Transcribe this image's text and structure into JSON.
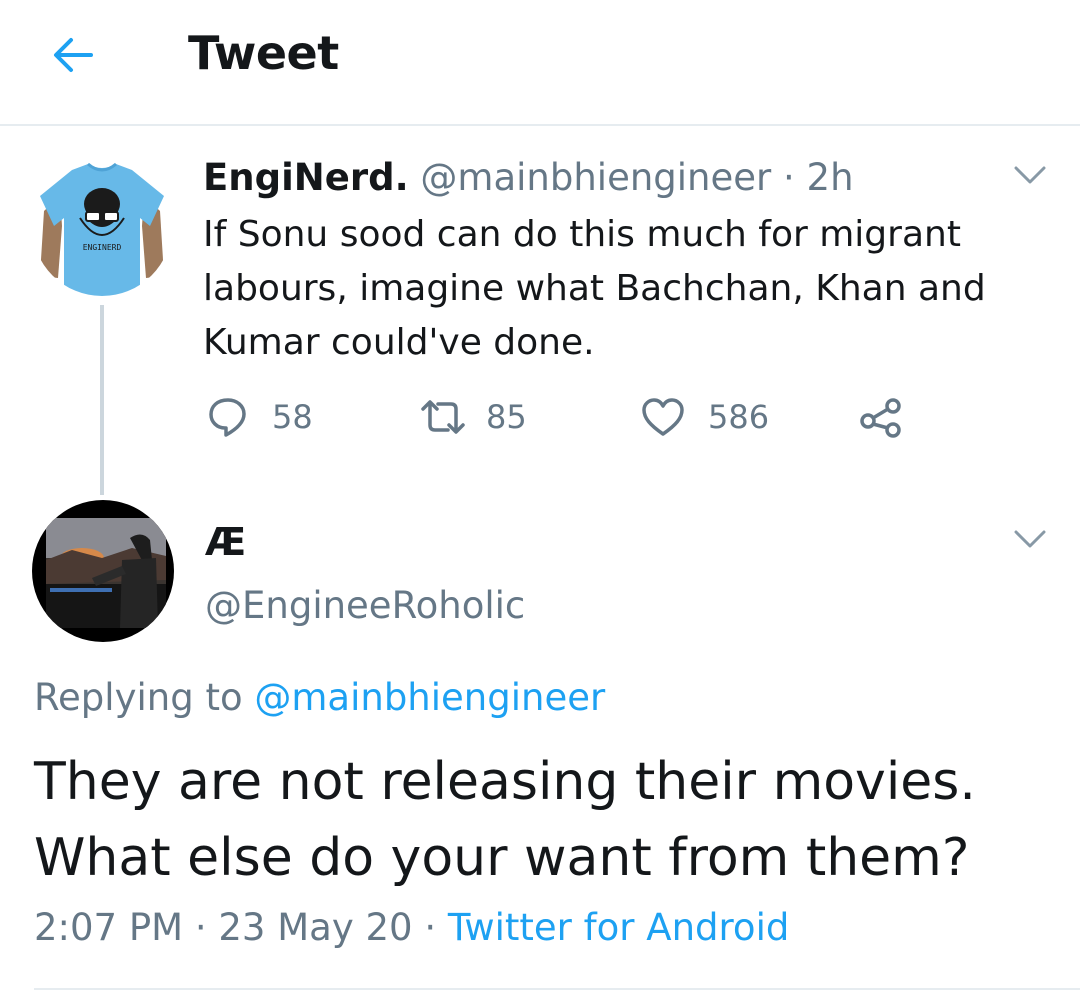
{
  "colors": {
    "accent": "#1da1f2",
    "muted": "#657786",
    "text": "#14171a",
    "divider": "#e6ecf0"
  },
  "header": {
    "title": "Tweet",
    "back_icon": "arrow-left-icon"
  },
  "parent_tweet": {
    "name": "EngiNerd.",
    "handle": "@mainbhiengineer",
    "separator": "·",
    "time": "2h",
    "text": "If Sonu sood can do this much for migrant labours, imagine what Bachchan, Khan and Kumar could've done.",
    "avatar_text": "ENGINERD",
    "actions": {
      "replies": "58",
      "retweets": "85",
      "likes": "586"
    }
  },
  "main_tweet": {
    "name": "Æ",
    "handle": "@EngineeRoholic",
    "replying_prefix": "Replying to",
    "replying_to": "@mainbhiengineer",
    "text": "They are not releasing their movies. What else do your want from them?",
    "time": "2:07 PM",
    "date": "23 May 20",
    "separator": "·",
    "source": "Twitter for Android"
  }
}
